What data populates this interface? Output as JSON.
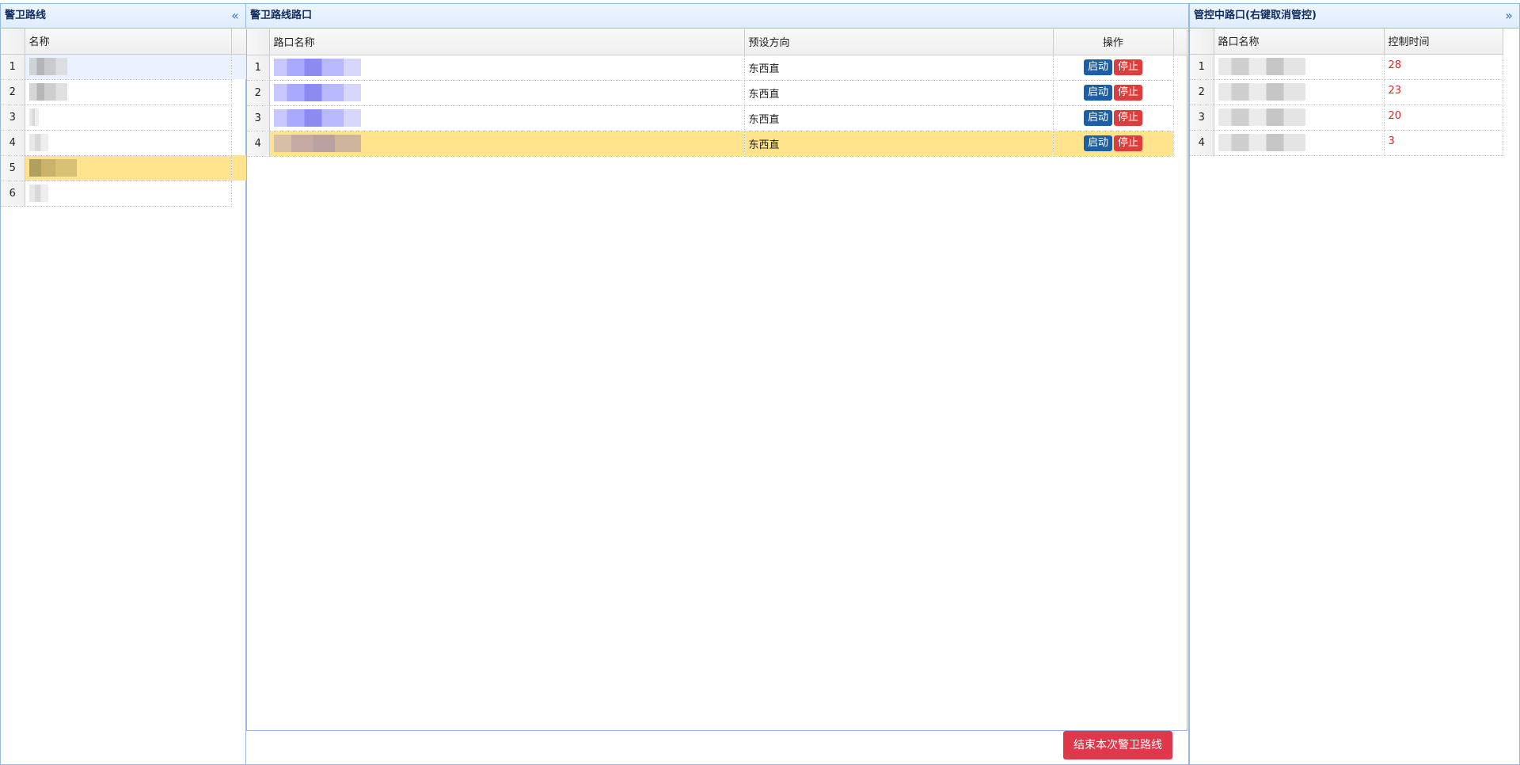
{
  "left_panel": {
    "title": "警卫路线",
    "collapse_icon": "«",
    "columns": {
      "name": "名称"
    },
    "rows": [
      {
        "num": "1",
        "style": "b-gray",
        "w": 48
      },
      {
        "num": "2",
        "style": "b-gray",
        "w": 48
      },
      {
        "num": "3",
        "style": "b-lgray",
        "w": 12
      },
      {
        "num": "4",
        "style": "b-lgray",
        "w": 24
      },
      {
        "num": "5",
        "style": "b-gold",
        "w": 60
      },
      {
        "num": "6",
        "style": "b-lgray",
        "w": 24
      }
    ]
  },
  "middle_panel": {
    "title": "警卫路线路口",
    "columns": {
      "name": "路口名称",
      "direction": "预设方向",
      "action": "操作"
    },
    "rows": [
      {
        "num": "1",
        "direction": "东西直",
        "start": "启动",
        "stop": "停止"
      },
      {
        "num": "2",
        "direction": "东西直",
        "start": "启动",
        "stop": "停止"
      },
      {
        "num": "3",
        "direction": "东西直",
        "start": "启动",
        "stop": "停止"
      },
      {
        "num": "4",
        "direction": "东西直",
        "start": "启动",
        "stop": "停止"
      }
    ],
    "end_button": "结束本次警卫路线"
  },
  "right_panel": {
    "title": "管控中路口(右键取消管控)",
    "collapse_icon": "»",
    "columns": {
      "name": "路口名称",
      "time": "控制时间"
    },
    "rows": [
      {
        "num": "1",
        "time": "28"
      },
      {
        "num": "2",
        "time": "23"
      },
      {
        "num": "3",
        "time": "20"
      },
      {
        "num": "4",
        "time": "3"
      }
    ]
  },
  "colors": {
    "header_border": "#95b8e7",
    "selected_row": "#ffe48d",
    "start_button": "#1a5fa8",
    "stop_button": "#e23b3b",
    "time_text": "#e22222",
    "end_button": "#e0384a"
  }
}
